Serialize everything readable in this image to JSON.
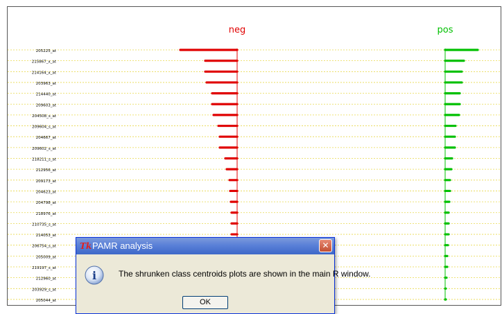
{
  "plot": {
    "classes": [
      {
        "name": "neg",
        "color": "#e00000"
      },
      {
        "name": "pos",
        "color": "#00c000"
      }
    ],
    "genes": [
      {
        "id": "205225_at",
        "neg": -0.82,
        "pos": 0.47
      },
      {
        "id": "215867_x_at",
        "neg": -0.46,
        "pos": 0.27
      },
      {
        "id": "214164_x_at",
        "neg": -0.46,
        "pos": 0.24
      },
      {
        "id": "203963_at",
        "neg": -0.44,
        "pos": 0.24
      },
      {
        "id": "214440_at",
        "neg": -0.36,
        "pos": 0.21
      },
      {
        "id": "209603_at",
        "neg": -0.36,
        "pos": 0.21
      },
      {
        "id": "204508_s_at",
        "neg": -0.34,
        "pos": 0.2
      },
      {
        "id": "209604_s_at",
        "neg": -0.27,
        "pos": 0.15
      },
      {
        "id": "204667_at",
        "neg": -0.25,
        "pos": 0.14
      },
      {
        "id": "209602_s_at",
        "neg": -0.25,
        "pos": 0.14
      },
      {
        "id": "218211_s_at",
        "neg": -0.17,
        "pos": 0.1
      },
      {
        "id": "212956_at",
        "neg": -0.15,
        "pos": 0.09
      },
      {
        "id": "209173_at",
        "neg": -0.11,
        "pos": 0.07
      },
      {
        "id": "204623_at",
        "neg": -0.1,
        "pos": 0.07
      },
      {
        "id": "204798_at",
        "neg": -0.09,
        "pos": 0.06
      },
      {
        "id": "218976_at",
        "neg": -0.08,
        "pos": 0.05
      },
      {
        "id": "210735_s_at",
        "neg": -0.08,
        "pos": 0.05
      },
      {
        "id": "214053_at",
        "neg": -0.08,
        "pos": 0.05
      },
      {
        "id": "206754_s_at",
        "neg": -0.06,
        "pos": 0.04
      },
      {
        "id": "205009_at",
        "neg": -0.05,
        "pos": 0.03
      },
      {
        "id": "219197_s_at",
        "neg": -0.04,
        "pos": 0.03
      },
      {
        "id": "212960_at",
        "neg": -0.03,
        "pos": 0.02
      },
      {
        "id": "203929_s_at",
        "neg": -0.02,
        "pos": 0.01
      },
      {
        "id": "205044_at",
        "neg": -0.01,
        "pos": 0.01
      }
    ]
  },
  "dialog": {
    "title": "PAMR analysis",
    "icon_tk": "Tk",
    "message": "The shrunken class centroids plots are shown in the main R window.",
    "ok_label": "OK",
    "close_label": "✕",
    "icon": "info-icon",
    "icon_text": "i"
  }
}
